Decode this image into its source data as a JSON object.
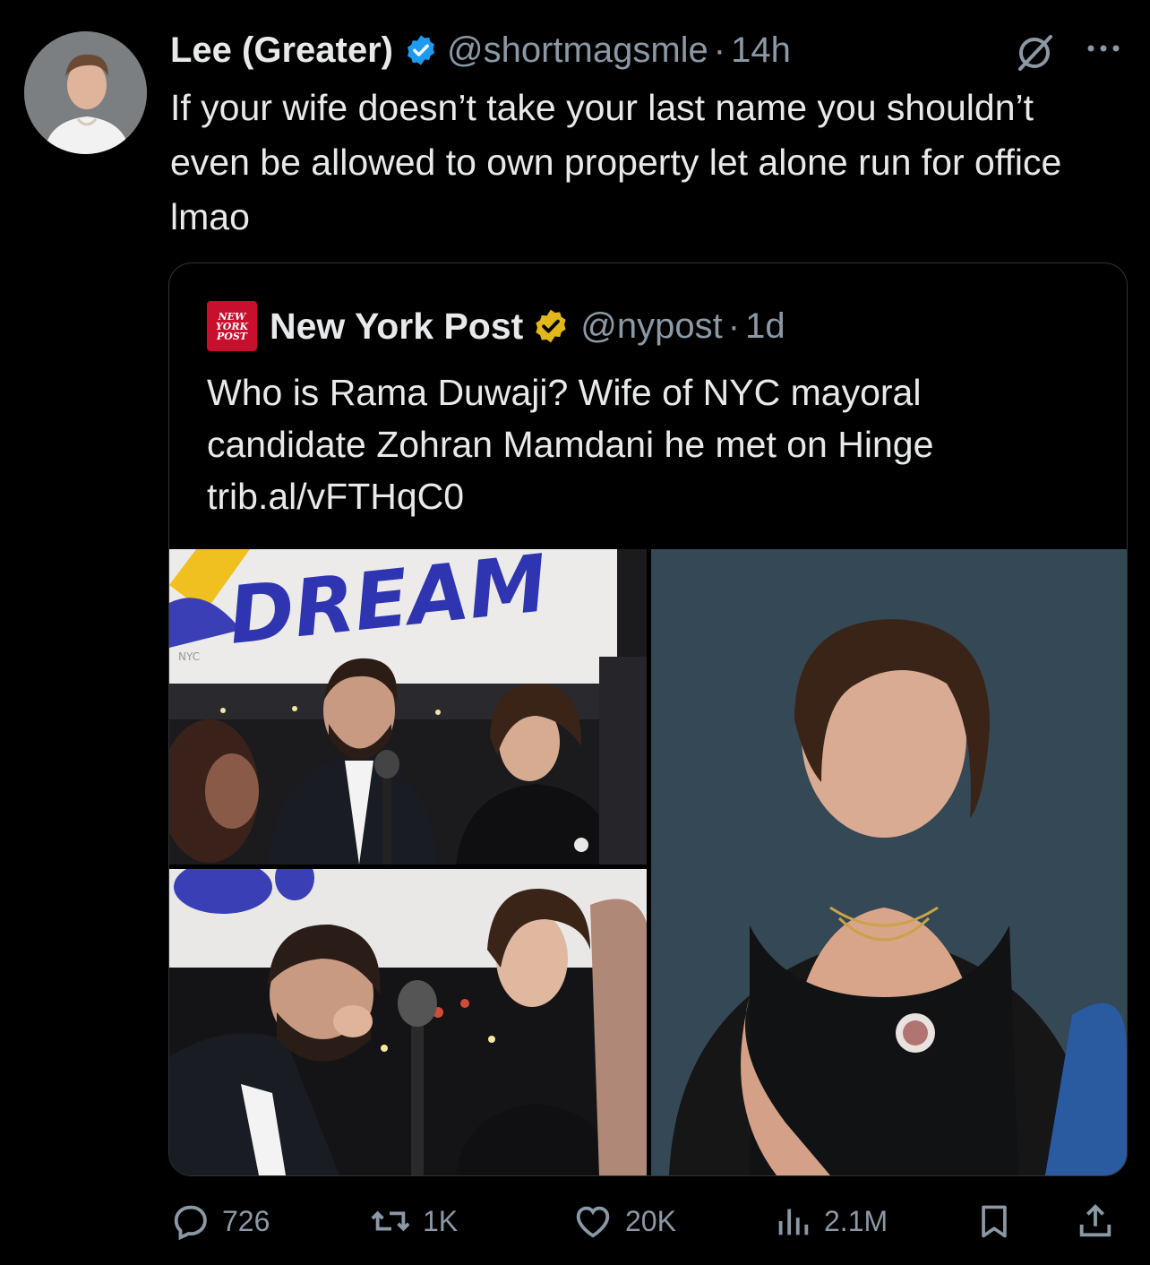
{
  "tweet": {
    "author_name": "Lee (Greater)",
    "handle": "@shortmagsmle",
    "separator": "·",
    "time": "14h",
    "text": "If your wife doesn’t take your last name you shouldn’t even be allowed to own property let alone run for office lmao"
  },
  "quote": {
    "logo_lines": [
      "NEW",
      "YORK",
      "POST"
    ],
    "author_name": "New York Post",
    "handle": "@nypost",
    "separator": "·",
    "time": "1d",
    "text_line1": "Who is Rama Duwaji? Wife of NYC mayoral",
    "text_line2": "candidate Zohran Mamdani he met on Hinge",
    "link": "trib.al/vFTHqC0",
    "banner_text": "DREAM",
    "banner_small": "NYC"
  },
  "actions": {
    "replies": "726",
    "reposts": "1K",
    "likes": "20K",
    "views": "2.1M"
  },
  "colors": {
    "background": "#000000",
    "text": "#e7e9ea",
    "muted": "#8b98a5",
    "verified_blue": "#1d9bf0",
    "verified_gold": "#e2b719",
    "nypost_red": "#c8102e"
  }
}
